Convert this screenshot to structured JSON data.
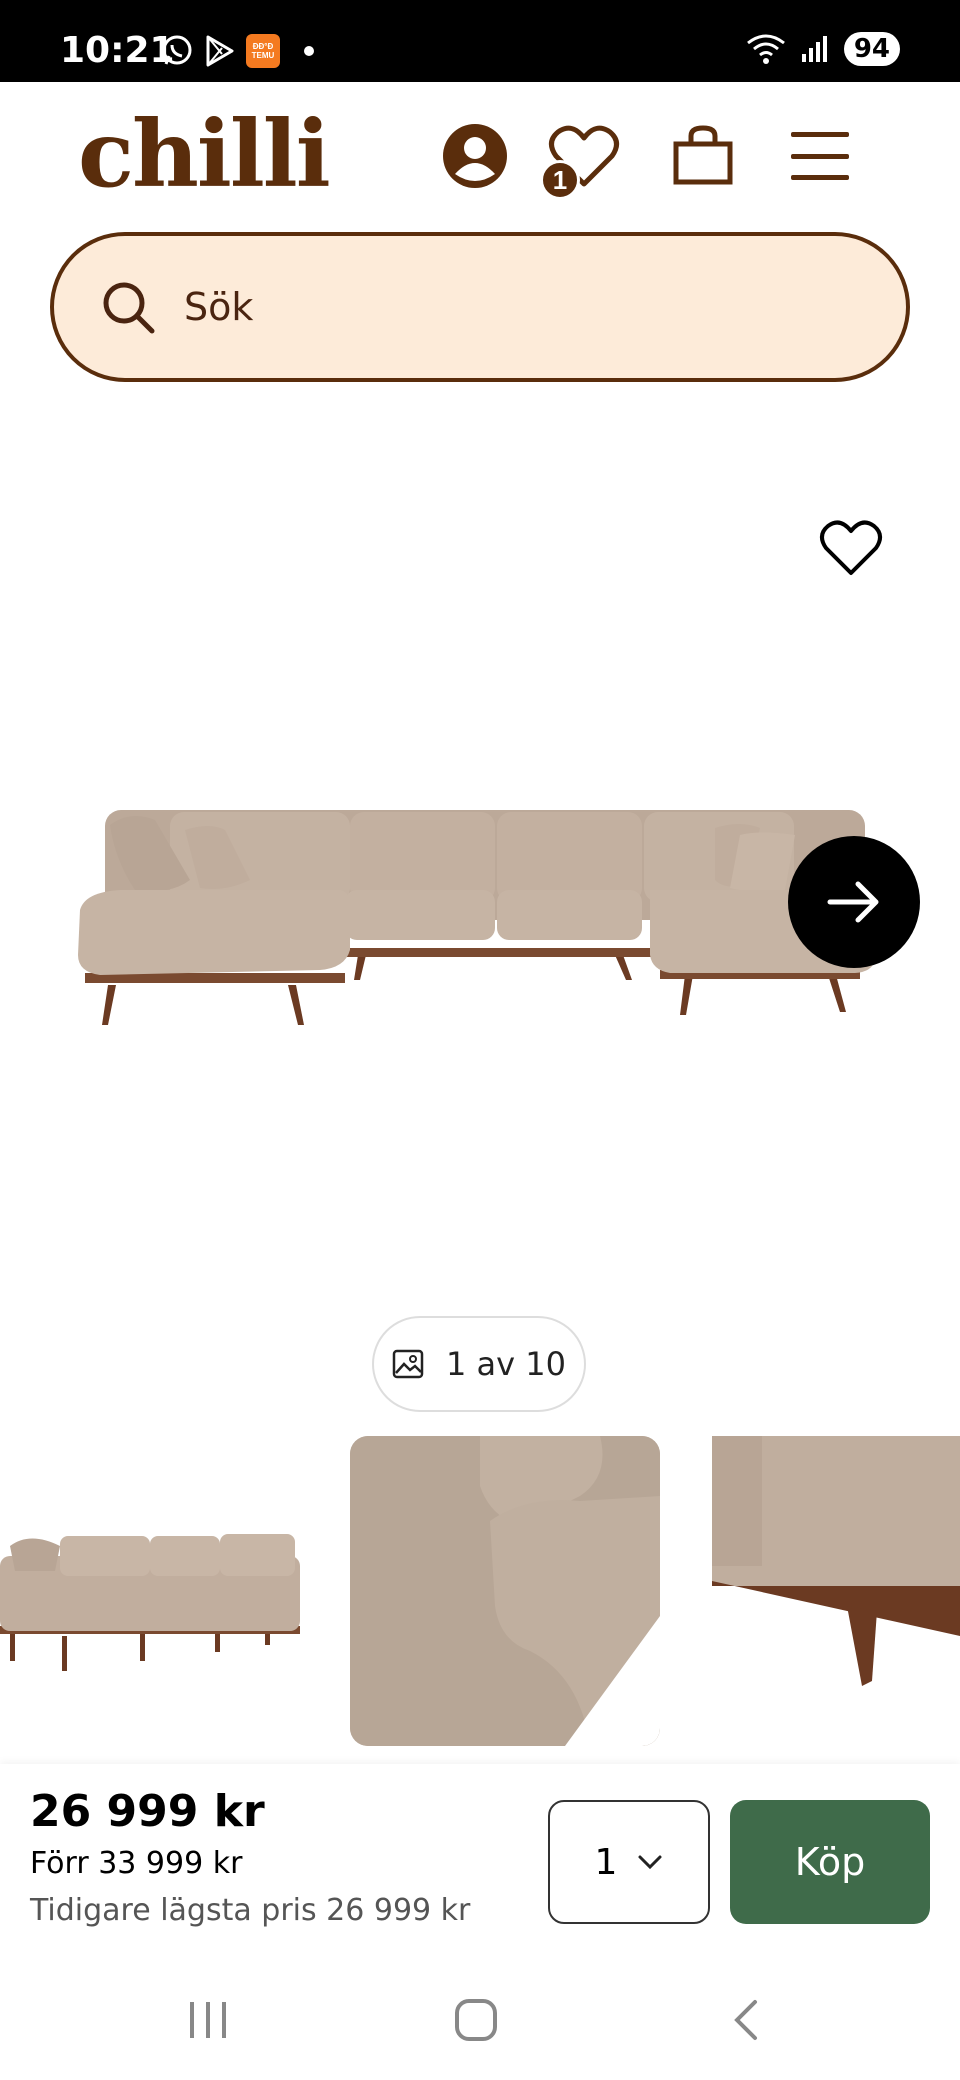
{
  "status_bar": {
    "time": "10:21",
    "battery": "94",
    "temu_label_top": "ĐĐ°Đ",
    "temu_label": "TEMU"
  },
  "header": {
    "logo": "chilli",
    "wishlist_count": "1"
  },
  "search": {
    "placeholder": "Sök"
  },
  "gallery": {
    "counter": "1 av 10"
  },
  "purchase": {
    "price": "26 999 kr",
    "previous_price": "Förr 33 999 kr",
    "lowest_price": "Tidigare lägsta pris 26 999 kr",
    "quantity": "1",
    "buy_label": "Köp"
  },
  "colors": {
    "brand_brown": "#5a2d0c",
    "search_bg": "#fdebd9",
    "buy_green": "#3f6b4a"
  },
  "icons": [
    "whatsapp-icon",
    "play-store-icon",
    "temu-icon",
    "wifi-icon",
    "signal-icon",
    "account-icon",
    "heart-icon",
    "bag-icon",
    "menu-icon",
    "search-icon",
    "arrow-right-icon",
    "image-icon",
    "chevron-down-icon",
    "recents-icon",
    "home-icon",
    "back-icon"
  ]
}
